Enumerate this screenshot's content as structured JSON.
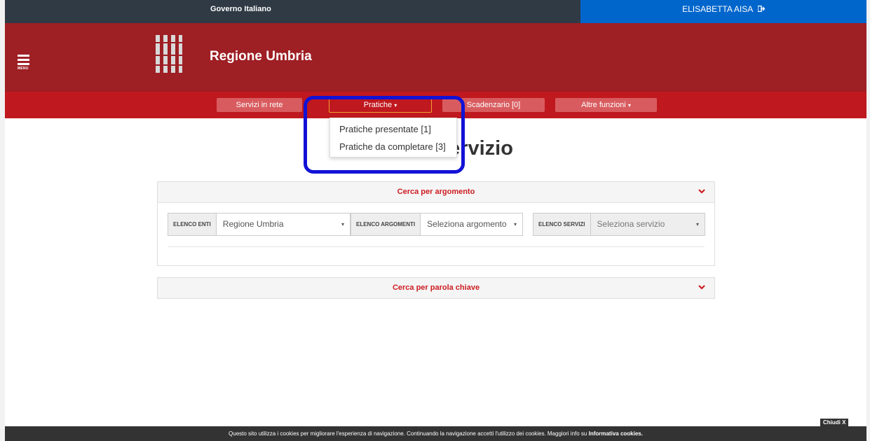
{
  "top": {
    "gov_label": "Governo Italiano",
    "user_name": "ELISABETTA AISA",
    "logout_icon": "sign-out-icon"
  },
  "header": {
    "menu_label": "MENU",
    "title": "Regione Umbria",
    "logo_icon": "regione-umbria-logo"
  },
  "nav": {
    "servizi": "Servizi in rete",
    "pratiche": "Pratiche",
    "scadenzario": "Scadenzario [0]",
    "altre": "Altre funzioni",
    "caret": "▾"
  },
  "dropdown": {
    "items": [
      "Pratiche presentate [1]",
      "Pratiche da completare [3]"
    ]
  },
  "main": {
    "heading": "Ricerca servizio"
  },
  "panel1": {
    "title": "Cerca per argomento",
    "enti_label": "ELENCO ENTI",
    "enti_value": "Regione Umbria",
    "argomenti_label": "ELENCO ARGOMENTI",
    "argomenti_value": "Seleziona argomento",
    "servizi_label": "ELENCO SERVIZI",
    "servizi_value": "Seleziona servizio",
    "arrow": "▾"
  },
  "panel2": {
    "title": "Cerca per parola chiave"
  },
  "cookie": {
    "text": "Questo sito utilizza i cookies per migliorare l'esperienza di navigazione. Continuando la navigazione accetti l'utilizzo dei cookies. Maggiori info su ",
    "link": "Informativa cookies.",
    "close": "Chiudi X"
  },
  "colors": {
    "header": "#9e1f24",
    "nav": "#c0181f",
    "user_bar": "#0066cc",
    "highlight": "#1212d6"
  }
}
